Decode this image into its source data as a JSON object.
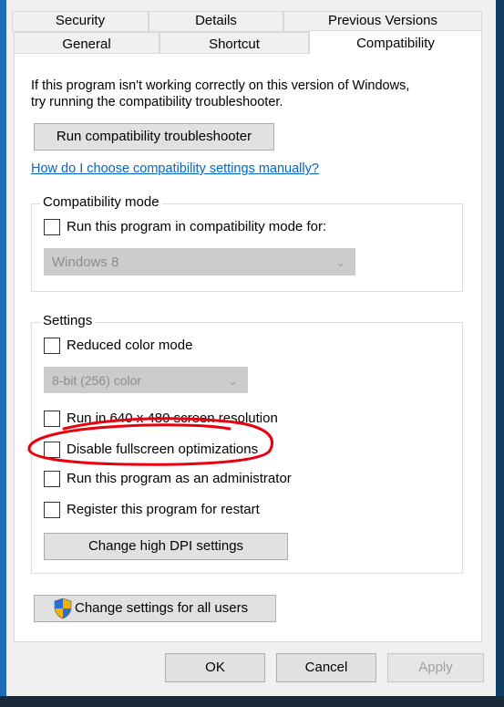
{
  "tabs_row1": [
    "Security",
    "Details",
    "Previous Versions"
  ],
  "tabs_row2": [
    "General",
    "Shortcut",
    "Compatibility"
  ],
  "active_tab": "Compatibility",
  "intro_text_line1": "If this program isn't working correctly on this version of Windows,",
  "intro_text_line2": "try running the compatibility troubleshooter.",
  "troubleshooter_button": "Run compatibility troubleshooter",
  "manual_link": "How do I choose compatibility settings manually?",
  "compat_mode": {
    "title": "Compatibility mode",
    "checkbox_label": "Run this program in compatibility mode for:",
    "checked": false,
    "selected_os": "Windows 8"
  },
  "settings": {
    "title": "Settings",
    "reduced_color_label": "Reduced color mode",
    "color_select_value": "8-bit (256) color",
    "options": [
      {
        "label": "Run in 640 x 480 screen resolution",
        "checked": false
      },
      {
        "label": "Disable fullscreen optimizations",
        "checked": false
      },
      {
        "label": "Run this program as an administrator",
        "checked": false
      },
      {
        "label": "Register this program for restart",
        "checked": false
      }
    ],
    "dpi_button": "Change high DPI settings"
  },
  "all_users_button": "Change settings for all users",
  "footer": {
    "ok": "OK",
    "cancel": "Cancel",
    "apply": "Apply"
  },
  "annotation_color": "#e8000f",
  "frame_color": "#1e6fb8",
  "link_color": "#0066cc"
}
